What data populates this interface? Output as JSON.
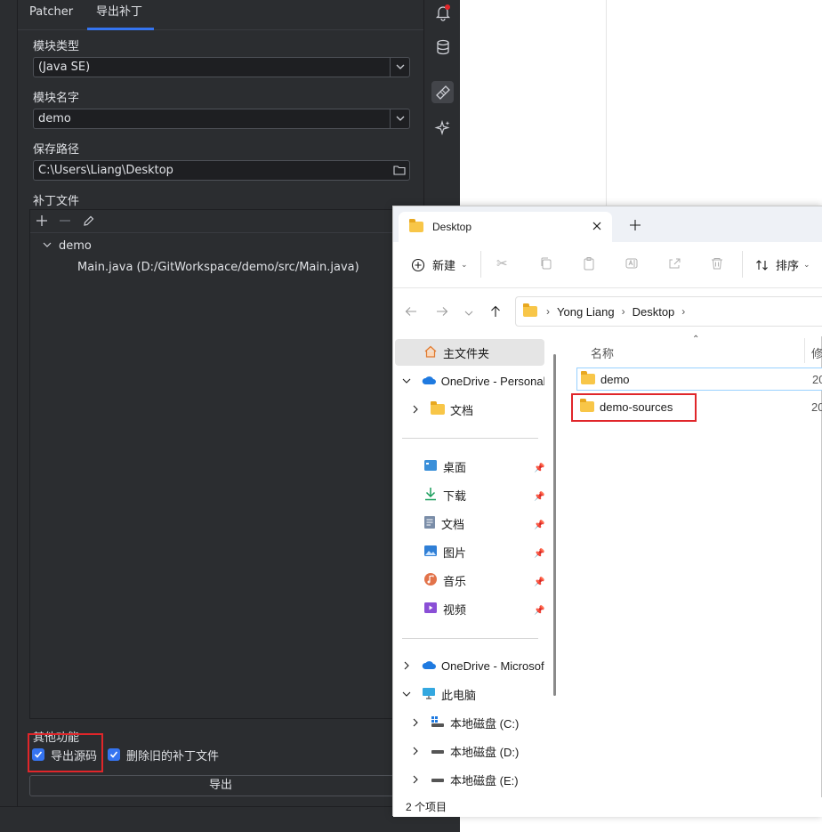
{
  "ide": {
    "tabs": [
      "Patcher",
      "导出补丁"
    ],
    "module_type_label": "模块类型",
    "module_type_value": "(Java SE)",
    "module_name_label": "模块名字",
    "module_name_value": "demo",
    "save_path_label": "保存路径",
    "save_path_value": "C:\\Users\\Liang\\Desktop",
    "patch_files_label": "补丁文件",
    "tree": {
      "root": "demo",
      "child": "Main.java (D:/GitWorkspace/demo/src/Main.java)"
    },
    "other_label": "其他功能",
    "export_source_label": "导出源码",
    "delete_old_label": "删除旧的补丁文件",
    "export_button": "导出"
  },
  "explorer": {
    "tab_title": "Desktop",
    "new_label": "新建",
    "sort_label": "排序",
    "breadcrumb": [
      "Yong Liang",
      "Desktop"
    ],
    "nav": {
      "home": "主文件夹",
      "onedrive_personal": "OneDrive - Personal",
      "docs_sub": "文档",
      "desktop": "桌面",
      "downloads": "下载",
      "documents": "文档",
      "pictures": "图片",
      "music": "音乐",
      "videos": "视频",
      "onedrive_ms": "OneDrive - Microsof",
      "this_pc": "此电脑",
      "drive_c": "本地磁盘 (C:)",
      "drive_d": "本地磁盘 (D:)",
      "drive_e": "本地磁盘 (E:)"
    },
    "col_name": "名称",
    "col_modified": "修",
    "files": [
      {
        "name": "demo",
        "date": "20"
      },
      {
        "name": "demo-sources",
        "date": "20"
      }
    ],
    "status": "2 个项目"
  },
  "colors": {
    "ide_bg": "#2b2d30",
    "accent": "#3574f0",
    "highlight": "#e0262a",
    "folder": "#f8c648"
  }
}
